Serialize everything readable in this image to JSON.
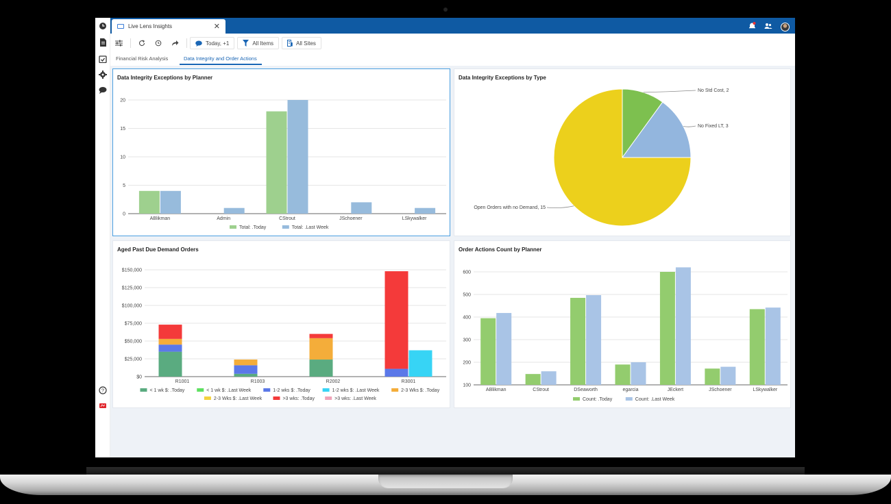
{
  "window": {
    "tab_title": "Live Lens Insights",
    "close_glyph": "✕"
  },
  "toolbar": {
    "date_filter": "Today, +1",
    "items_filter": "All Items",
    "sites_filter": "All Sites"
  },
  "subtabs": {
    "financial": "Financial Risk Analysis",
    "integrity": "Data Integrity and Order Actions"
  },
  "colors": {
    "topbar": "#0f5aa3",
    "accent": "#1a66b5",
    "green": "#9ed08e",
    "blue": "#97bbdc"
  },
  "rail_icons": [
    "clock-icon",
    "document-icon",
    "calendar-check-icon",
    "gear-icon",
    "chat-icon",
    "help-icon",
    "logo-icon"
  ],
  "panels": {
    "p1_title": "Data Integrity Exceptions by Planner",
    "p2_title": "Data Integrity Exceptions by Type",
    "p3_title": "Aged Past Due Demand Orders",
    "p4_title": "Order Actions Count by Planner"
  },
  "chart_data": [
    {
      "type": "bar",
      "title": "Data Integrity Exceptions by Planner",
      "categories": [
        "ABlikman",
        "Admin",
        "CStrout",
        "JSchoener",
        "LSkywalker"
      ],
      "series": [
        {
          "name": "Total: .Today",
          "values": [
            4,
            0,
            18,
            0,
            0
          ],
          "color": "#9ed08e"
        },
        {
          "name": "Total: .Last Week",
          "values": [
            4,
            1,
            20,
            2,
            1
          ],
          "color": "#97bbdc"
        }
      ],
      "yticks": [
        0,
        5,
        10,
        15,
        20
      ],
      "ylim": [
        0,
        20
      ],
      "legend": "bottom"
    },
    {
      "type": "pie",
      "title": "Data Integrity Exceptions by Type",
      "slices": [
        {
          "label": "No Std Cost, 2",
          "value": 2,
          "color": "#7dc04f"
        },
        {
          "label": "No Fixed LT, 3",
          "value": 3,
          "color": "#93b6de"
        },
        {
          "label": "Open Orders with no Demand, 15",
          "value": 15,
          "color": "#ecd01c"
        }
      ]
    },
    {
      "type": "bar",
      "stacked": true,
      "title": "Aged Past Due Demand Orders",
      "categories": [
        "R1001",
        "R1003",
        "R2002",
        "R3001"
      ],
      "series": [
        {
          "name": "< 1 wk $: .Today",
          "color": "#5aab80",
          "values": [
            35000,
            4000,
            24000,
            0
          ],
          "group": "Today"
        },
        {
          "name": "< 1 wk $: .Last Week",
          "color": "#5ee060",
          "values": [
            0,
            0,
            0,
            0
          ],
          "group": "Last Week"
        },
        {
          "name": "1-2 wks $: .Today",
          "color": "#5b78e8",
          "values": [
            10000,
            12000,
            0,
            11000
          ],
          "group": "Today"
        },
        {
          "name": "1-2 wks $: .Last Week",
          "color": "#37d4f5",
          "values": [
            0,
            0,
            0,
            37000
          ],
          "group": "Last Week"
        },
        {
          "name": "2-3 Wks $: .Today",
          "color": "#f4ad3a",
          "values": [
            8000,
            8000,
            30000,
            0
          ],
          "group": "Today"
        },
        {
          "name": "2-3 Wks $: .Last Week",
          "color": "#f4d23f",
          "values": [
            0,
            0,
            0,
            0
          ],
          "group": "Last Week"
        },
        {
          "name": ">3 wks: .Today",
          "color": "#f43a3a",
          "values": [
            20000,
            0,
            6000,
            137000
          ],
          "group": "Today"
        },
        {
          "name": ">3 wks: .Last Week",
          "color": "#f0a3b8",
          "values": [
            0,
            0,
            0,
            0
          ],
          "group": "Last Week"
        }
      ],
      "yticks": [
        "$0",
        "$25,000",
        "$50,000",
        "$75,000",
        "$100,000",
        "$125,000",
        "$150,000"
      ],
      "ylim": [
        0,
        150000
      ],
      "legend": "bottom"
    },
    {
      "type": "bar",
      "title": "Order Actions Count by Planner",
      "categories": [
        "ABlikman",
        "CStrout",
        "DSeaworth",
        "egarcia",
        "JEckert",
        "JSchoener",
        "LSkywalker"
      ],
      "series": [
        {
          "name": "Count: .Today",
          "values": [
            395,
            148,
            485,
            190,
            600,
            172,
            435
          ],
          "color": "#93cc6e"
        },
        {
          "name": "Count: .Last Week",
          "values": [
            418,
            160,
            497,
            200,
            620,
            180,
            442
          ],
          "color": "#a9c4e6"
        }
      ],
      "yticks": [
        100,
        200,
        300,
        400,
        500,
        600
      ],
      "ylim": [
        100,
        600
      ],
      "legend": "bottom"
    }
  ]
}
